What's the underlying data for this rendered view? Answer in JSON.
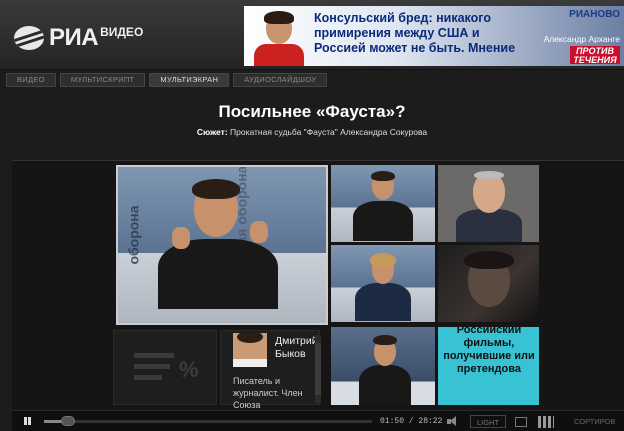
{
  "header": {
    "logo_main": "РИА",
    "logo_sub": "ВИДЕО"
  },
  "banner": {
    "headline": "Консульский бред: никакого примирения между США и Россией может не быть. Мнение",
    "brand": "РИАНОВО",
    "author": "Александр Арханге",
    "tag": "ПРОТИВ ТЕЧЕНИЯ"
  },
  "tabs": [
    {
      "label": "Видео",
      "active": false
    },
    {
      "label": "Мультискрипт",
      "active": false
    },
    {
      "label": "Мультиэкран",
      "active": true
    },
    {
      "label": "Аудиослайдшоу",
      "active": false
    }
  ],
  "page": {
    "title": "Посильнее «Фауста»?",
    "story_label": "Сюжет:",
    "story_text": " Прокатная судьба \"Фауста\" Александра Сокурова"
  },
  "tiles": {
    "main_word_1": "оборона",
    "main_word_2": "ая оборона"
  },
  "infocard": {
    "name": "Дмитрий Быков",
    "description": "Писатель и журналист. Член Союза"
  },
  "statscard": {
    "percent_symbol": "%"
  },
  "cyan_tile": {
    "text": "Российский фильмы, получившие или претендова"
  },
  "controls": {
    "time": "01:50 / 28:22",
    "progress": 0.065,
    "light_label": "LIGHT",
    "sort_label": "СОРТИРОВ"
  }
}
